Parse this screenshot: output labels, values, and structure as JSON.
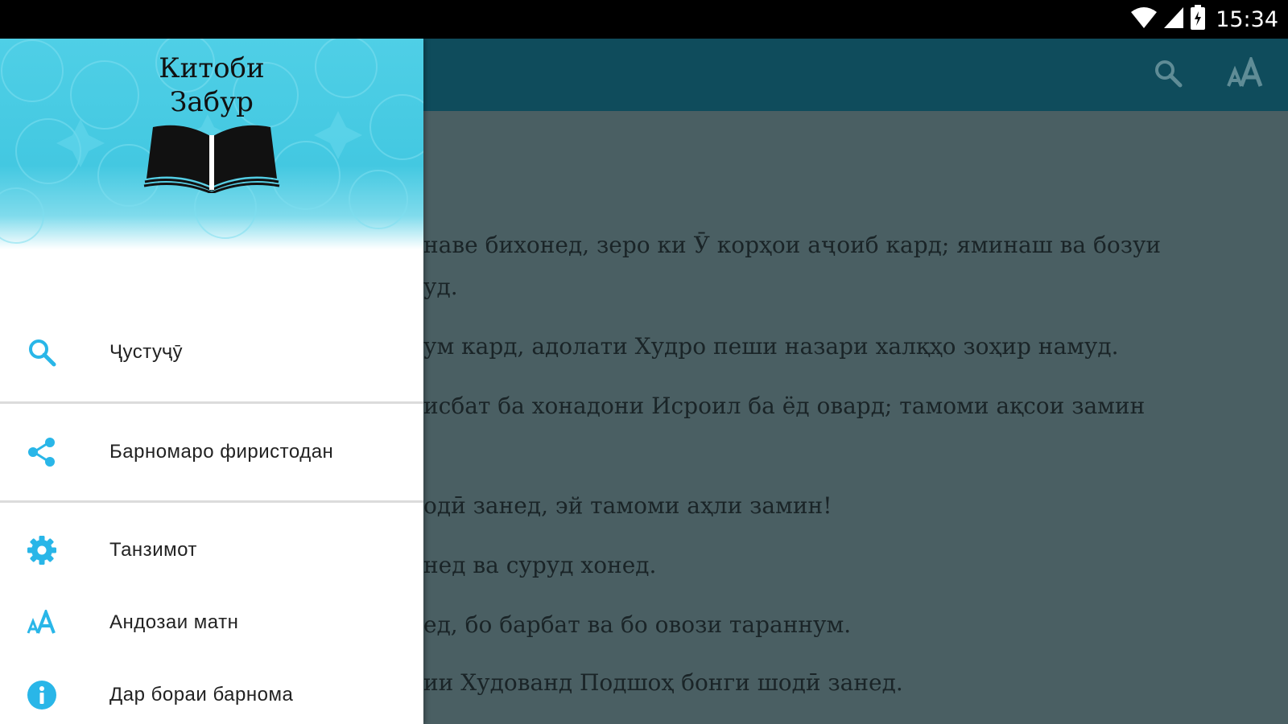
{
  "status_bar": {
    "time": "15:34",
    "icons": [
      "wifi-icon",
      "signal-icon",
      "battery-icon"
    ]
  },
  "toolbar": {
    "actions": [
      "search-icon",
      "text-size-icon"
    ],
    "colors": {
      "background": "#0f4c5c",
      "icon": "#5f8c96"
    }
  },
  "drawer": {
    "header": {
      "title_line1": "Китоби",
      "title_line2": "Забур",
      "logo_icon": "open-book-icon"
    },
    "items": [
      {
        "icon": "search-icon",
        "label": "Ҷустуҷӯ"
      },
      {
        "icon": "share-icon",
        "label": "Барномаро фиристодан"
      },
      {
        "icon": "gear-icon",
        "label": "Танзимот"
      },
      {
        "icon": "text-size-icon",
        "label": "Андозаи матн"
      },
      {
        "icon": "info-icon",
        "label": "Дар бораи барнома"
      }
    ],
    "accent_color": "#29b6e8"
  },
  "content": {
    "lines": [
      "наве бихонед, зеро ки Ӯ корҳои аҷоиб кард; яминаш ва бозуи",
      "уд.",
      "ум кард, адолати Худро пеши назари халқҳо зоҳир намуд.",
      "исбат ба хонадони Исроил ба ёд овард; тамоми ақсои замин",
      "одӣ занед, эй тамоми аҳли замин!",
      "нед ва суруд хонед.",
      "ед, бо барбат ва бо овози тараннум.",
      "ии Худованд Подшоҳ бонги шодӣ занед."
    ]
  }
}
